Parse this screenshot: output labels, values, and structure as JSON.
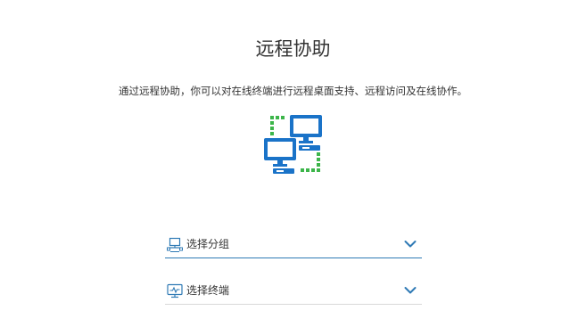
{
  "page": {
    "title": "远程协助",
    "description": "通过远程协助，你可以对在线终端进行远程桌面支持、远程访问及在线协作。"
  },
  "hero": {
    "icon": "remote-computers-icon",
    "colors": {
      "monitor": "#1a73c8",
      "link": "#3cb54a"
    }
  },
  "fields": {
    "group": {
      "label": "选择分组",
      "icon": "group-network-icon"
    },
    "terminal": {
      "label": "选择终端",
      "icon": "terminal-monitor-icon"
    }
  },
  "colors": {
    "accent": "#2f7ab5",
    "text": "#333333",
    "divider": "#d8d8d8"
  }
}
